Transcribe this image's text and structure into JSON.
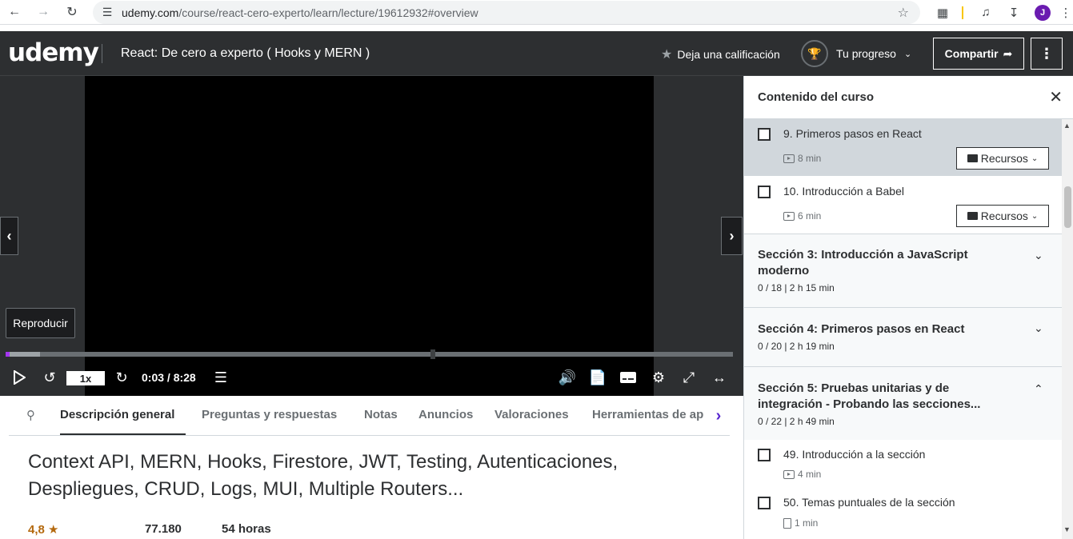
{
  "browser": {
    "url_host": "udemy.com",
    "url_path": "/course/react-cero-experto/learn/lecture/19612932#overview",
    "profile_initial": "J"
  },
  "header": {
    "logo": "udemy",
    "course_title": "React: De cero a experto ( Hooks y MERN )",
    "rate_label": "Deja una calificación",
    "progress_label": "Tu progreso",
    "share_label": "Compartir"
  },
  "player": {
    "tooltip": "Reproducir",
    "speed": "1x",
    "timecode": "0:03 / 8:28",
    "progress_fraction": 0.006,
    "buffer_fraction": 0.047
  },
  "tabs": [
    {
      "label": "Descripción general",
      "active": true
    },
    {
      "label": "Preguntas y respuestas"
    },
    {
      "label": "Notas"
    },
    {
      "label": "Anuncios"
    },
    {
      "label": "Valoraciones"
    },
    {
      "label": "Herramientas de ap"
    }
  ],
  "overview": {
    "headline": "Context API, MERN, Hooks, Firestore, JWT, Testing, Autenticaciones, Despliegues, CRUD, Logs, MUI, Multiple Routers...",
    "rating": "4,8",
    "students": "77.180",
    "hours": "54 horas"
  },
  "sidebar": {
    "title": "Contenido del curso",
    "resources_label": "Recursos",
    "lectures_top": [
      {
        "title": "9. Primeros pasos en React",
        "duration": "8 min"
      },
      {
        "title": "10. Introducción a Babel",
        "duration": "6 min"
      }
    ],
    "sections": [
      {
        "title": "Sección 3: Introducción a JavaScript moderno",
        "meta": "0 / 18 | 2 h 15 min"
      },
      {
        "title": "Sección 4: Primeros pasos en React",
        "meta": "0 / 20 | 2 h 19 min"
      },
      {
        "title": "Sección 5: Pruebas unitarias y de integración - Probando las secciones...",
        "meta": "0 / 22 | 2 h 49 min"
      }
    ],
    "lectures_bottom": [
      {
        "title": "49. Introducción a la sección",
        "duration": "4 min"
      },
      {
        "title": "50. Temas puntuales de la sección",
        "duration": "1 min"
      }
    ]
  }
}
